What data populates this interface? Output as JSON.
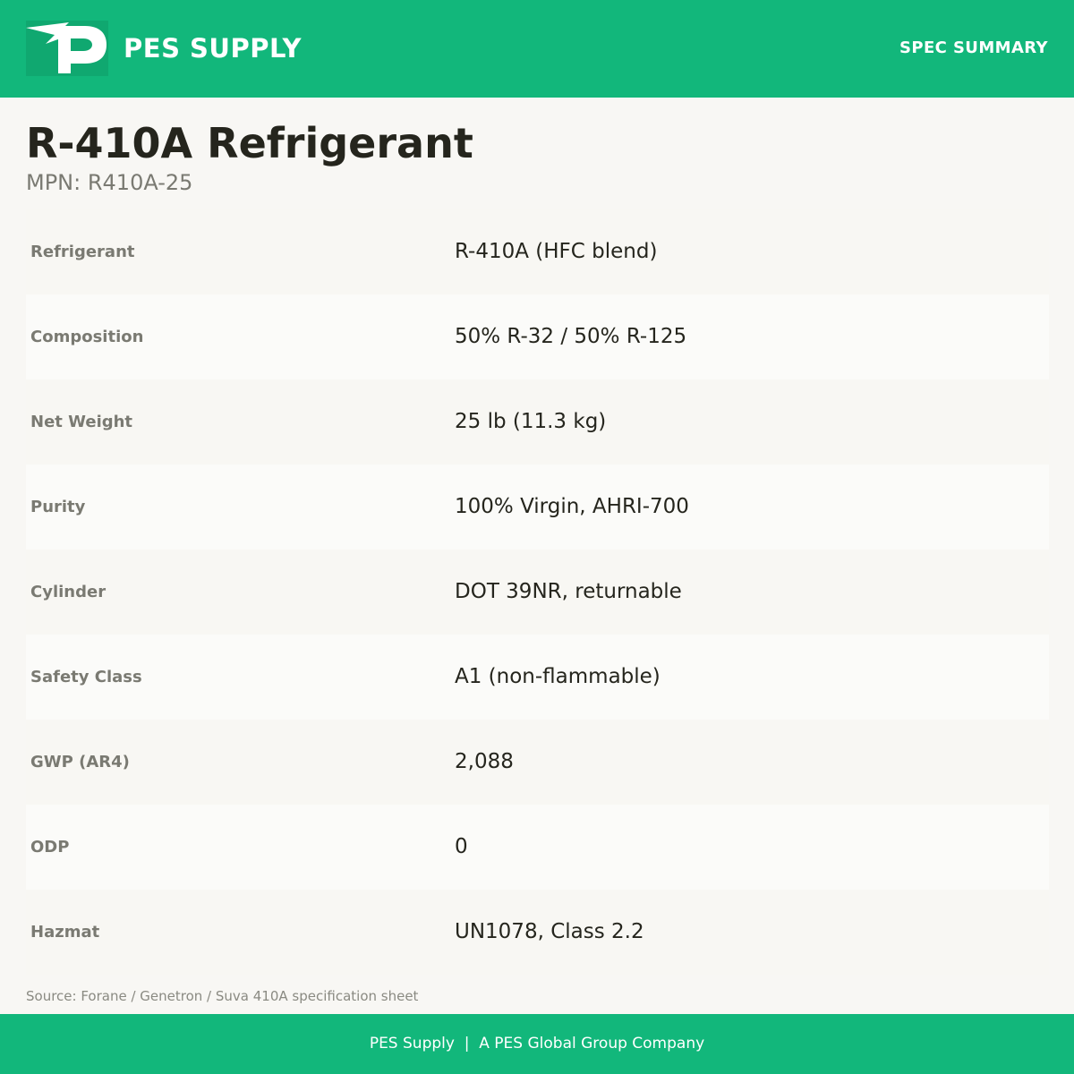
{
  "colors": {
    "brand_green": "#12b77b",
    "title_text": "#25251d",
    "muted_text": "#7a7a72",
    "page_background": "#f8f7f4"
  },
  "header": {
    "logo_icon": "pes-p-bolt-logo-icon",
    "brand_name": "PES SUPPLY",
    "doc_label": "SPEC SUMMARY"
  },
  "product": {
    "title": "R-410A Refrigerant",
    "mpn": "MPN: R410A-25"
  },
  "specs": [
    {
      "label": "Refrigerant",
      "value": "R-410A (HFC blend)"
    },
    {
      "label": "Composition",
      "value": "50% R-32 / 50% R-125"
    },
    {
      "label": "Net Weight",
      "value": "25 lb (11.3 kg)"
    },
    {
      "label": "Purity",
      "value": "100% Virgin, AHRI-700"
    },
    {
      "label": "Cylinder",
      "value": "DOT 39NR, returnable"
    },
    {
      "label": "Safety Class",
      "value": "A1 (non-flammable)"
    },
    {
      "label": "GWP (AR4)",
      "value": "2,088"
    },
    {
      "label": "ODP",
      "value": "0"
    },
    {
      "label": "Hazmat",
      "value": "UN1078, Class 2.2"
    }
  ],
  "source": "Source: Forane / Genetron / Suva 410A specification sheet",
  "footer": {
    "text": "PES Supply  |  A PES Global Group Company"
  }
}
